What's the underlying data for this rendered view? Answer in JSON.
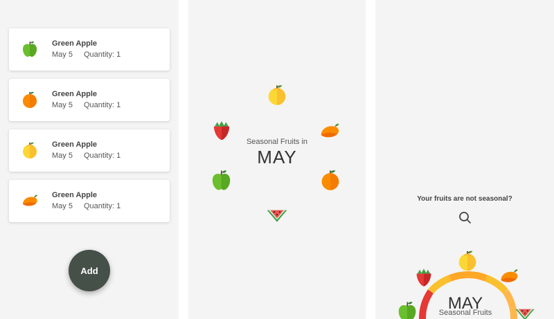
{
  "list": {
    "items": [
      {
        "name": "Green Apple",
        "date": "May 5",
        "quantity": "Quantity: 1",
        "icon": "green-apple-icon"
      },
      {
        "name": "Green Apple",
        "date": "May 5",
        "quantity": "Quantity: 1",
        "icon": "orange-icon"
      },
      {
        "name": "Green Apple",
        "date": "May 5",
        "quantity": "Quantity: 1",
        "icon": "lemon-icon"
      },
      {
        "name": "Green Apple",
        "date": "May 5",
        "quantity": "Quantity: 1",
        "icon": "mango-icon"
      }
    ],
    "add_label": "Add"
  },
  "wheel": {
    "title": "Seasonal Fruits in",
    "month": "MAY",
    "fruits": [
      "lemon-icon",
      "mango-icon",
      "orange-icon",
      "watermelon-icon",
      "green-apple-icon",
      "strawberry-icon"
    ]
  },
  "seasonal": {
    "question": "Your fruits are not seasonal?",
    "month": "MAY",
    "subtitle": "Seasonal Fruits"
  },
  "colors": {
    "background": "#f4f4f4",
    "add_button": "#455049",
    "arc_red": "#e53935",
    "arc_orange": "#ffa726",
    "arc_yellow": "#fbc02d",
    "arc_green": "#7cb342"
  }
}
